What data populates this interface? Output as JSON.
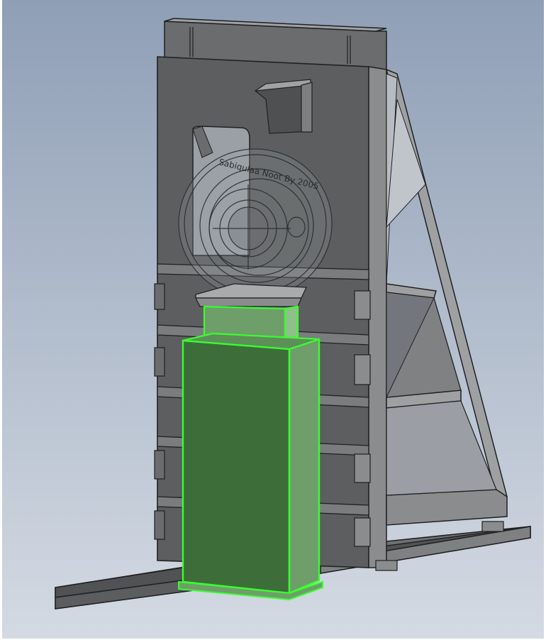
{
  "viewport": {
    "background_top": "#8f9fb6",
    "background_bottom": "#d4dae3"
  },
  "model": {
    "engraving_text": "Sabiqulaa Noot By 2005",
    "colors": {
      "frame_face": "#5c5e5f",
      "frame_side": "#8a8c8d",
      "frame_top": "#9ea0a1",
      "edge": "#1f2122",
      "base_top": "#505253",
      "base_side": "#6e7071",
      "selected_face": "#3d6e3a",
      "selected_side": "#6e9e6a",
      "selected_edge": "#39ff2e",
      "transparent_part": "#9fa3a8"
    }
  }
}
